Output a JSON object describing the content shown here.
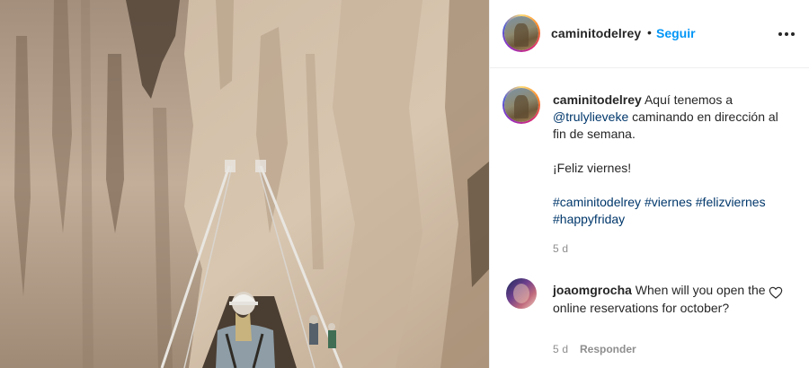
{
  "post": {
    "photo_alt": "",
    "header": {
      "username": "caminitodelrey",
      "separator": "•",
      "follow_label": "Seguir",
      "more_icon": "more-horizontal-icon"
    },
    "caption": {
      "username": "caminitodelrey",
      "text_before_mention": "Aquí tenemos a",
      "mention": "@trulylieveke",
      "text_after_mention": "caminando en dirección al fin de semana.",
      "line2": "¡Feliz viernes!",
      "hashtags": [
        "#caminitodelrey",
        "#viernes",
        "#felizviernes",
        "#happyfriday"
      ],
      "time": "5 d"
    },
    "comments": [
      {
        "username": "joaomgrocha",
        "text": "When will you open the online reservations for october?",
        "time": "5 d",
        "reply_label": "Responder",
        "like_icon": "heart-outline-icon"
      }
    ]
  },
  "colors": {
    "link_blue": "#0095f6",
    "mention_blue": "#00376b",
    "text": "#262626",
    "muted": "#8e8e8e",
    "border": "#efefef"
  }
}
